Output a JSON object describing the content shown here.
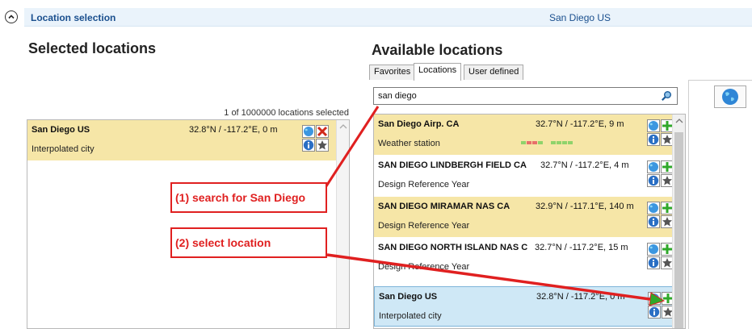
{
  "header": {
    "title": "Location selection",
    "current_location": "San Diego US"
  },
  "selected": {
    "heading": "Selected locations",
    "count_label": "1 of 1000000 locations selected",
    "items": [
      {
        "name": "San Diego US",
        "coords": "32.8°N / -117.2°E, 0 m",
        "type": "Interpolated city"
      }
    ]
  },
  "available": {
    "heading": "Available locations",
    "tabs": [
      {
        "label": "Favorites"
      },
      {
        "label": "Locations",
        "active": true
      },
      {
        "label": "User defined"
      }
    ],
    "search": {
      "value": "san diego"
    },
    "items": [
      {
        "name": "San Diego Airp. CA",
        "coords": "32.7°N / -117.2°E, 9 m",
        "type": "Weather station"
      },
      {
        "name": "SAN DIEGO LINDBERGH FIELD CA",
        "coords": "32.7°N / -117.2°E, 4 m",
        "type": "Design Reference Year"
      },
      {
        "name": "SAN DIEGO MIRAMAR NAS CA",
        "coords": "32.9°N / -117.1°E, 140 m",
        "type": "Design Reference Year"
      },
      {
        "name": "SAN DIEGO NORTH ISLAND NAS C",
        "coords": "32.7°N / -117.2°E, 15 m",
        "type": "Design Reference Year"
      },
      {
        "name": "San Diego US",
        "coords": "32.8°N / -117.2°E, 0 m",
        "type": "Interpolated city"
      }
    ]
  },
  "annotations": {
    "step1": "(1) search for San Diego",
    "step2": "(2) select location"
  },
  "colors": {
    "highlight_row": "#f6e6a7",
    "selected_row": "#cfe8f6",
    "annotation": "#e02020",
    "header_text": "#1a4f8e"
  },
  "icons": [
    "collapse-chevron-up-icon",
    "search-icon",
    "globe-icon",
    "info-icon",
    "star-icon",
    "add-plus-icon",
    "remove-x-icon"
  ]
}
